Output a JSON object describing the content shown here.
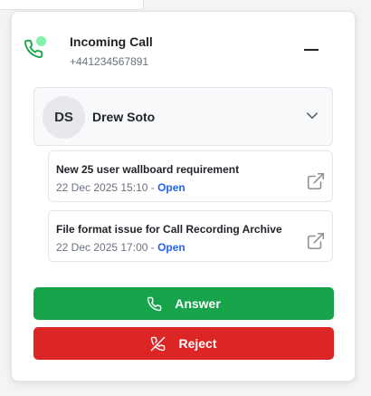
{
  "call": {
    "title": "Incoming Call",
    "number": "+441234567891",
    "status_dot_color": "#86efac"
  },
  "contact": {
    "initials": "DS",
    "name": "Drew Soto"
  },
  "tickets": [
    {
      "title": "New 25 user wallboard requirement",
      "datetime": "22 Dec 2025 15:10",
      "separator": " - ",
      "status": "Open"
    },
    {
      "title": "File format issue for Call Recording Archive",
      "datetime": "22 Dec 2025 17:00",
      "separator": " - ",
      "status": "Open"
    }
  ],
  "actions": {
    "answer_label": "Answer",
    "reject_label": "Reject"
  },
  "icons": {
    "phone": "phone-icon",
    "minimize": "minimize-icon",
    "chevron": "chevron-down-icon",
    "external": "external-link-icon",
    "phone_off": "phone-off-icon"
  },
  "colors": {
    "accent_green": "#16a34a",
    "accent_red": "#dc2626",
    "status_link": "#2563eb"
  }
}
